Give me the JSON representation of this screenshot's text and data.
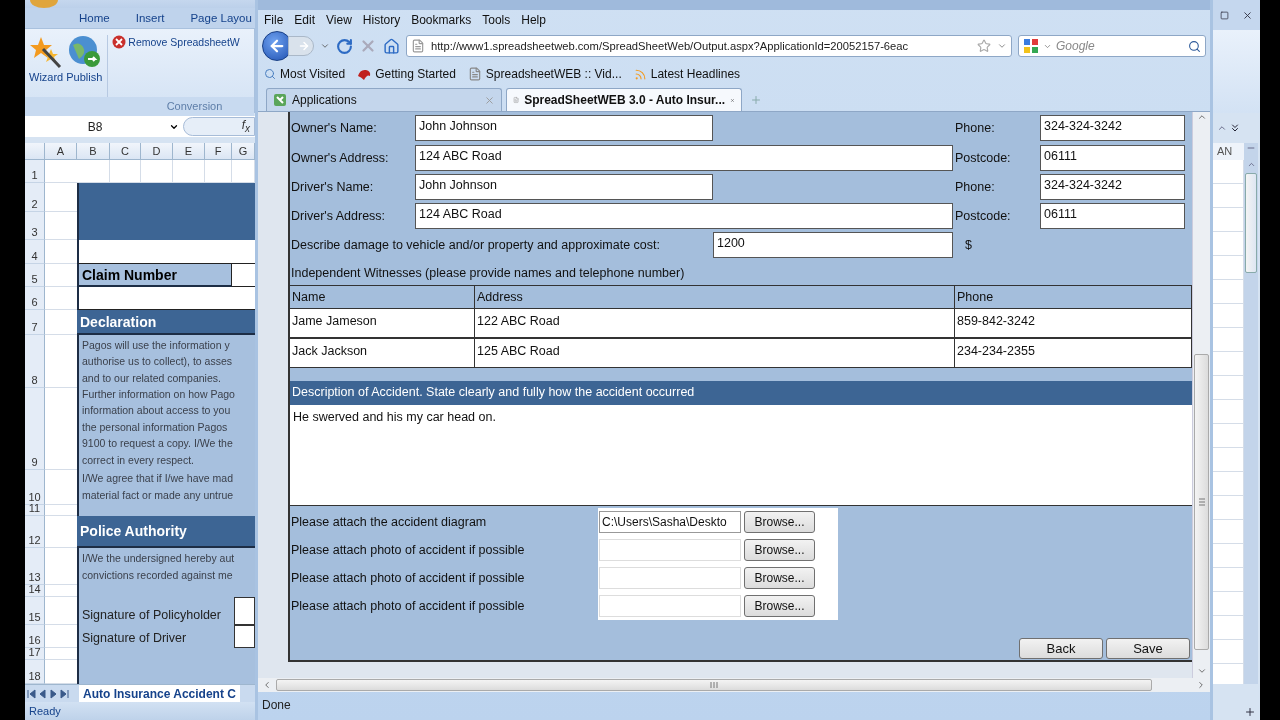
{
  "excel": {
    "ribbon_tabs": [
      {
        "label": "Home"
      },
      {
        "label": "Insert"
      },
      {
        "label": "Page Layou"
      }
    ],
    "big_buttons": [
      {
        "label": "Wizard",
        "kind": "wizard"
      },
      {
        "label": "Publish",
        "kind": "publish"
      }
    ],
    "remove_button": "Remove SpreadsheetW",
    "group_label": "Conversion",
    "name_box": "B8",
    "formula_label": "f$_{x}$",
    "columns": [
      "A",
      "B",
      "C",
      "D",
      "E",
      "F",
      "G"
    ],
    "rows": [
      {
        "number": "1",
        "kind": "blank"
      },
      {
        "number": "2",
        "kind": "banner"
      },
      {
        "number": "3",
        "kind": "banner"
      },
      {
        "number": "4",
        "kind": "white"
      },
      {
        "number": "5",
        "kind": "claim",
        "text": "Claim Number"
      },
      {
        "number": "6",
        "kind": "white"
      },
      {
        "number": "7",
        "kind": "heading",
        "text": "Declaration"
      },
      {
        "number": "8",
        "kind": "text",
        "lines": [
          "Pagos will use the information y",
          "authorise us to collect), to asses",
          "and to our related companies."
        ]
      },
      {
        "number": "9",
        "kind": "text",
        "lines": [
          "Further information on how Pago",
          "information about access to you",
          "the personal information Pagos",
          "9100 to request a copy. I/We the",
          "correct in every respect."
        ]
      },
      {
        "number": "10",
        "kind": "text",
        "lines": [
          "I/We agree that if I/we have mad",
          "material fact or made any untrue"
        ]
      },
      {
        "number": "11",
        "kind": "empty"
      },
      {
        "number": "12",
        "kind": "heading",
        "text": "Police Authority"
      },
      {
        "number": "13",
        "kind": "text",
        "lines": [
          "I/We the undersigned hereby aut",
          "convictions recorded against me"
        ]
      },
      {
        "number": "14",
        "kind": "empty"
      },
      {
        "number": "15",
        "kind": "signature",
        "text": "Signature of Policyholder"
      },
      {
        "number": "16",
        "kind": "signature",
        "text": "Signature of Driver"
      },
      {
        "number": "17",
        "kind": "empty"
      },
      {
        "number": "18",
        "kind": "empty"
      }
    ],
    "sheet_tab": "Auto Insurance Accident C",
    "status": "Ready",
    "right_column": "AN"
  },
  "browser": {
    "menu": [
      {
        "label": "File"
      },
      {
        "label": "Edit"
      },
      {
        "label": "View"
      },
      {
        "label": "History"
      },
      {
        "label": "Bookmarks"
      },
      {
        "label": "Tools"
      },
      {
        "label": "Help"
      }
    ],
    "url": "http://www1.spreadsheetweb.com/SpreadSheetWeb/Output.aspx?ApplicationId=20052157-6eac",
    "search_placeholder": "Google",
    "bookmarks": [
      {
        "label": "Most Visited",
        "kind": "search"
      },
      {
        "label": "Getting Started",
        "kind": "fox"
      },
      {
        "label": "SpreadsheetWEB :: Vid...",
        "kind": "page"
      },
      {
        "label": "Latest Headlines",
        "kind": "feed"
      }
    ],
    "tabs": [
      {
        "label": "Applications",
        "selected": false
      },
      {
        "label": "SpreadSheetWEB 3.0 - Auto Insur...",
        "selected": true
      }
    ],
    "status": "Done"
  },
  "form": {
    "contact_rows": [
      {
        "label": "Owner's Name:",
        "value": "John Johnson",
        "kind": "short",
        "side_label": "Phone:",
        "side_value": "324-324-3242"
      },
      {
        "label": "Owner's Address:",
        "value": "124 ABC Road",
        "kind": "long",
        "side_label": "Postcode:",
        "side_value": "06111"
      },
      {
        "label": "Driver's Name:",
        "value": "John Johnson",
        "kind": "short",
        "side_label": "Phone:",
        "side_value": "324-324-3242"
      },
      {
        "label": "Driver's Address:",
        "value": "124 ABC Road",
        "kind": "long",
        "side_label": "Postcode:",
        "side_value": "06111"
      }
    ],
    "damage": {
      "label": "Describe damage to vehicle and/or property and approximate cost:",
      "value": "1200",
      "unit": "$"
    },
    "witnesses": {
      "title": "Independent Witnesses (please provide names and telephone number)",
      "columns": [
        "Name",
        "Address",
        "Phone"
      ],
      "rows": [
        [
          "Jame Jameson",
          "122 ABC Road",
          "859-842-3242"
        ],
        [
          "Jack Jackson",
          "125 ABC Road",
          "234-234-2355"
        ]
      ]
    },
    "description": {
      "title": "Description of Accident. State clearly and fully how the accident occurred",
      "value": "He swerved and his my car head on."
    },
    "attachments": [
      {
        "label": "Please attach the accident diagram",
        "value": "C:\\Users\\Sasha\\Deskto",
        "button": "Browse..."
      },
      {
        "label": "Please attach photo of accident if possible",
        "button": "Browse..."
      },
      {
        "label": "Please attach photo of accident if possible",
        "button": "Browse..."
      },
      {
        "label": "Please attach photo of accident if possible",
        "button": "Browse..."
      }
    ],
    "actions": [
      {
        "label": "Back"
      },
      {
        "label": "Save"
      }
    ]
  }
}
